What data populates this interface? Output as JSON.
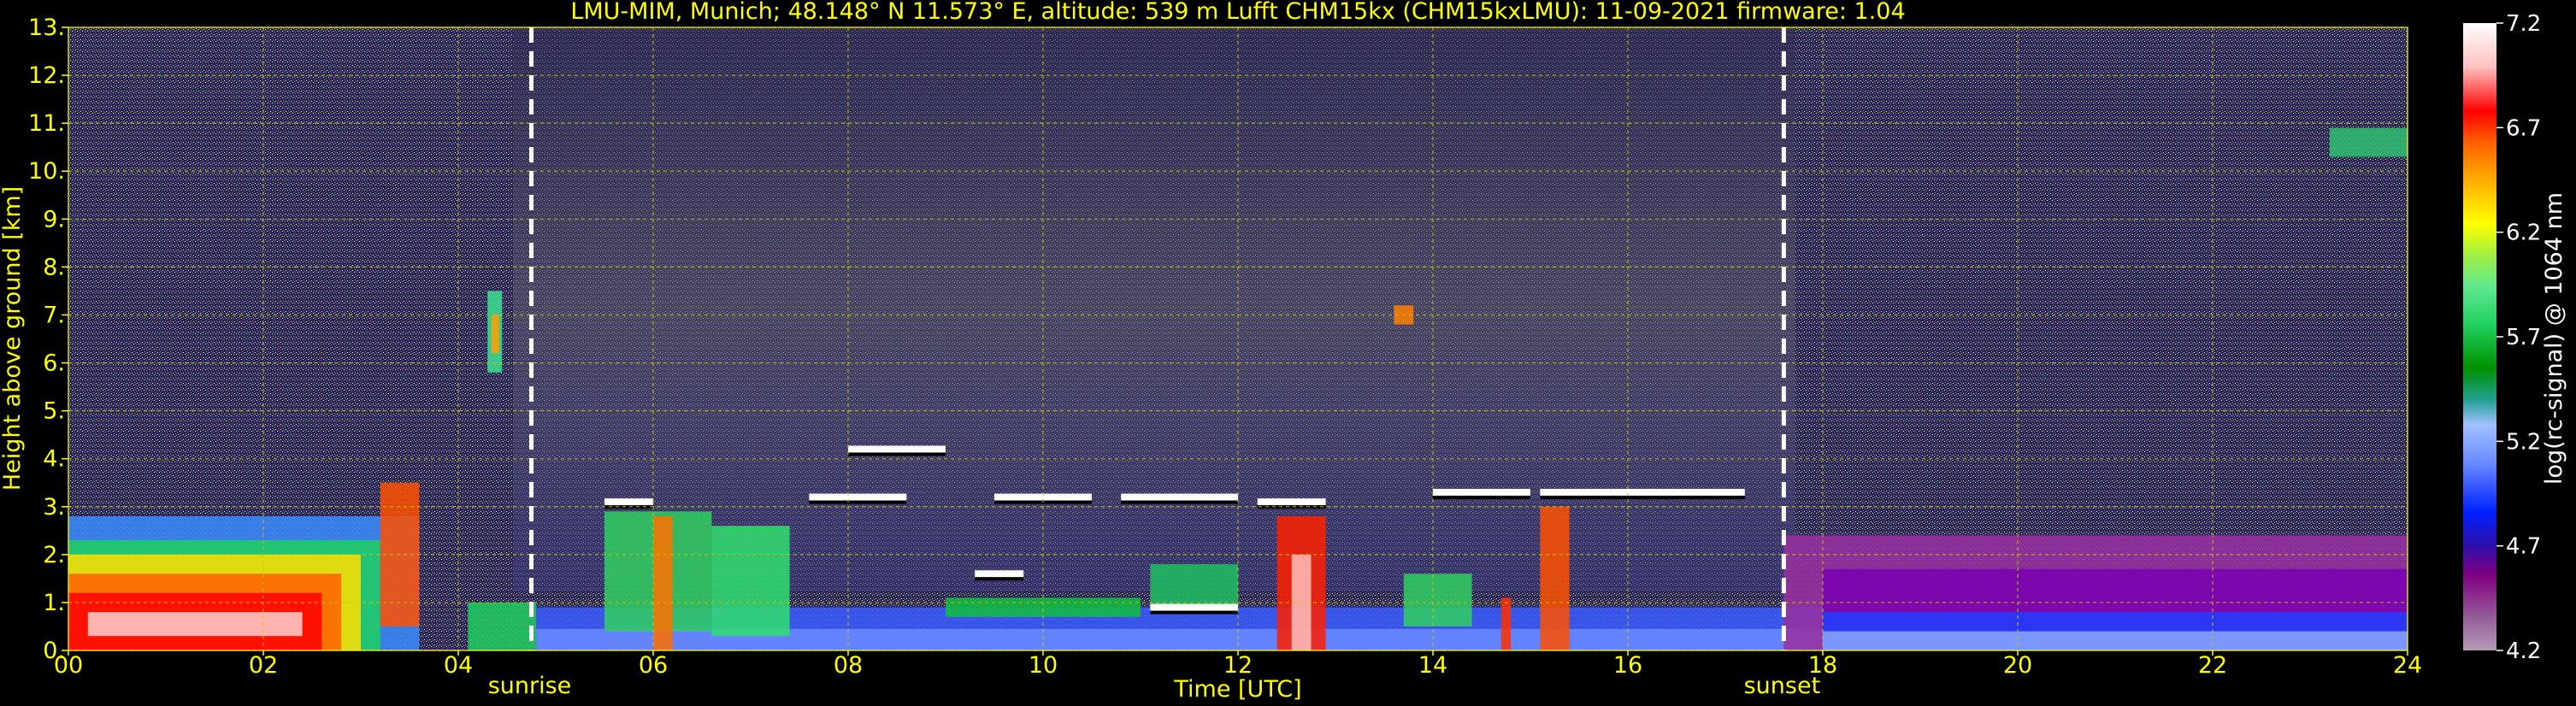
{
  "title": "LMU-MIM, Munich; 48.148° N 11.573° E, altitude: 539 m    Lufft CHM15kx (CHM15kxLMU): 11-09-2021    firmware: 1.04",
  "chart_data": {
    "type": "heatmap",
    "title": "LMU-MIM, Munich; 48.148° N 11.573° E, altitude: 539 m    Lufft CHM15kx (CHM15kxLMU): 11-09-2021    firmware: 1.04",
    "xlabel": "Time [UTC]",
    "ylabel": "Height above ground [km]",
    "colorbar_label": "log(rc-signal) @ 1064 nm",
    "xlim": [
      0,
      24
    ],
    "ylim": [
      0,
      13
    ],
    "x_ticks": [
      "00",
      "02",
      "04",
      "06",
      "08",
      "10",
      "12",
      "14",
      "16",
      "18",
      "20",
      "22",
      "24"
    ],
    "y_ticks": [
      "0.",
      "1.",
      "2.",
      "3.",
      "4.",
      "5.",
      "6.",
      "7.",
      "8.",
      "9.",
      "10.",
      "11.",
      "12.",
      "13."
    ],
    "colorbar_range": [
      4.2,
      7.2
    ],
    "colorbar_ticks": [
      "4.2",
      "4.7",
      "5.2",
      "5.7",
      "6.2",
      "6.7",
      "7.2"
    ],
    "grid": true,
    "annotations": [
      {
        "label": "sunrise",
        "x": 4.75
      },
      {
        "label": "sunset",
        "x": 17.6
      }
    ],
    "colormap": [
      "#a58ea5",
      "#8f4f8f",
      "#800080",
      "#3a1aa0",
      "#0000ff",
      "#3a5cff",
      "#7a9cff",
      "#9ab8ff",
      "#10b090",
      "#009000",
      "#10c040",
      "#30e070",
      "#90f060",
      "#ffff00",
      "#ffc000",
      "#ff8000",
      "#ff0000",
      "#ffb0b0",
      "#ffffff"
    ]
  }
}
